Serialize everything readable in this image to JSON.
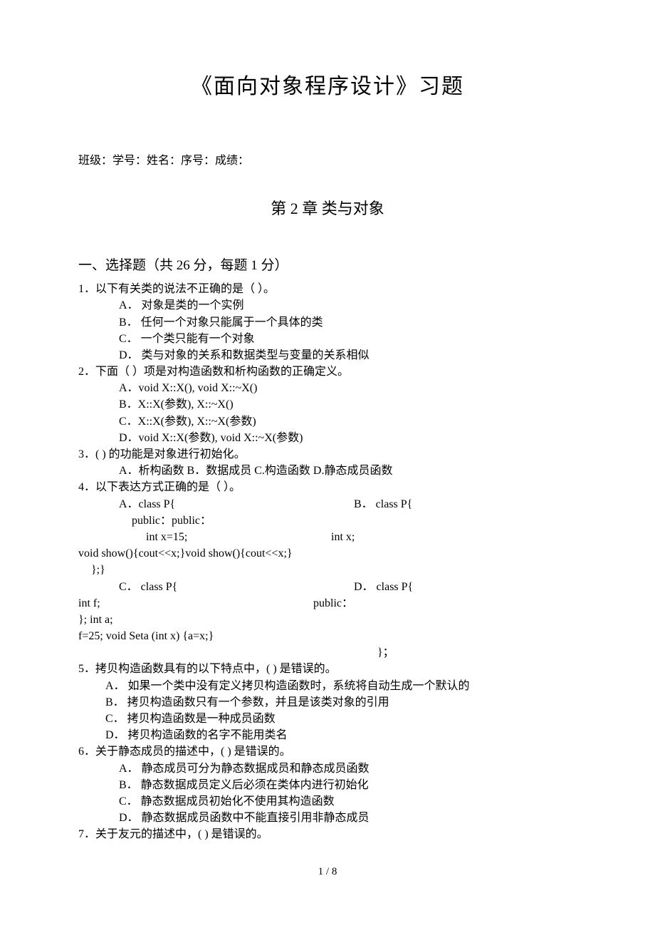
{
  "title": "《面向对象程序设计》习题",
  "info": "班级：学号：姓名：序号：成绩：",
  "chapter": "第 2 章 类与对象",
  "section1": "一、选择题（共 26 分，每题 1 分）",
  "q1": {
    "stem": "1．以下有关类的说法不正确的是（        ）。",
    "a": "A． 对象是类的一个实例",
    "b": "B． 任何一个对象只能属于一个具体的类",
    "c": "C． 一个类只能有一个对象",
    "d": "D． 类与对象的关系和数据类型与变量的关系相似"
  },
  "q2": {
    "stem": "2．下面（        ）项是对构造函数和析构函数的正确定义。",
    "a": "A．void X::X(),   void X::~X()",
    "b": "B．X::X(参数),   X::~X()",
    "c": "C．X::X(参数),    X::~X(参数)",
    "d": "D．void X::X(参数),  void X::~X(参数)"
  },
  "q3": {
    "stem": "3．(        ) 的功能是对象进行初始化。",
    "opts": "A．析构函数       B．数据成员    C.构造函数    D.静态成员函数"
  },
  "q4": {
    "stem": "4．以下表达方式正确的是（        ）。",
    "row1_left": "A．class P{",
    "row1_right": "B．  class P{",
    "row2": "public：public：",
    "row3_left": "int x=15;",
    "row3_right": "int x;",
    "row4": "void  show(){cout<<x;}void show(){cout<<x;}",
    "row5": "};}",
    "row6_left": "C． class P{",
    "row6_right": "D．  class P{",
    "row7_left": "int  f;",
    "row7_right": "public：",
    "row8": "};   int a;",
    "row9": "f=25;      void Seta (int x) {a=x;}",
    "row10": "}；"
  },
  "q5": {
    "stem": "5．拷贝构造函数具有的以下特点中，(        ) 是错误的。",
    "a": "A． 如果一个类中没有定义拷贝构造函数时，系统将自动生成一个默认的",
    "b": "B． 拷贝构造函数只有一个参数，并且是该类对象的引用",
    "c": "C． 拷贝构造函数是一种成员函数",
    "d": "D． 拷贝构造函数的名字不能用类名"
  },
  "q6": {
    "stem": "6．关于静态成员的描述中，(        ) 是错误的。",
    "a": "A． 静态成员可分为静态数据成员和静态成员函数",
    "b": "B． 静态数据成员定义后必须在类体内进行初始化",
    "c": "C． 静态数据成员初始化不使用其构造函数",
    "d": "D． 静态数据成员函数中不能直接引用非静态成员"
  },
  "q7": {
    "stem": "7．关于友元的描述中，(        ) 是错误的。"
  },
  "page": "1 / 8"
}
